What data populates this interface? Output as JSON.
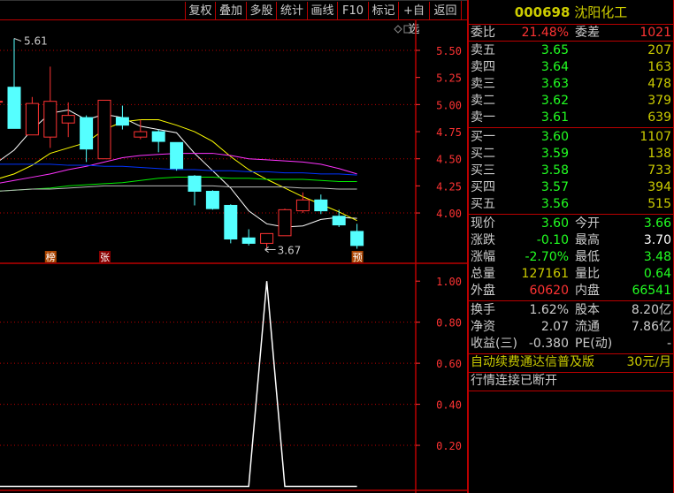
{
  "toolbar": {
    "buttons": [
      "复权",
      "叠加",
      "多股",
      "统计",
      "画线",
      "F10",
      "标记",
      "+自选",
      "返回"
    ]
  },
  "colors": {
    "up": "#ff3333",
    "down": "#55ffff",
    "ma5": "#ffffff",
    "ma10": "#ffff00",
    "ma20": "#ff33ff",
    "ma30": "#0033ff",
    "ma60": "#00ee00",
    "ma120": "#bbbbbb",
    "axis": "#ff3333"
  },
  "chart_data": [
    {
      "type": "candlestick",
      "title": "K线",
      "ylim": [
        3.6,
        5.65
      ],
      "yticks": [
        "5.50",
        "5.25",
        "5.00",
        "4.75",
        "4.50",
        "4.25",
        "4.00"
      ],
      "ytick_values": [
        5.5,
        5.25,
        5,
        4.75,
        4.5,
        4.25,
        4
      ],
      "ohlc": [
        [
          5.03,
          5.09,
          5.09,
          5.03
        ],
        [
          5.16,
          5.61,
          4.78,
          4.78
        ],
        [
          4.72,
          5.07,
          4.72,
          5.01
        ],
        [
          4.7,
          5.35,
          4.6,
          5.03
        ],
        [
          4.83,
          5.02,
          4.7,
          4.9
        ],
        [
          4.88,
          4.9,
          4.47,
          4.59
        ],
        [
          4.5,
          5.04,
          4.5,
          5.04
        ],
        [
          4.88,
          4.99,
          4.77,
          4.81
        ],
        [
          4.7,
          4.86,
          4.68,
          4.75
        ],
        [
          4.75,
          4.77,
          4.56,
          4.66
        ],
        [
          4.65,
          4.65,
          4.39,
          4.41
        ],
        [
          4.34,
          4.35,
          4.07,
          4.2
        ],
        [
          4.2,
          4.21,
          4.03,
          4.04
        ],
        [
          4.07,
          4.08,
          3.72,
          3.76
        ],
        [
          3.77,
          3.85,
          3.7,
          3.72
        ],
        [
          3.72,
          3.81,
          3.67,
          3.81
        ],
        [
          3.79,
          4.04,
          3.79,
          4.03
        ],
        [
          4.02,
          4.19,
          4.0,
          4.12
        ],
        [
          4.12,
          4.17,
          3.99,
          4.02
        ],
        [
          3.97,
          4.03,
          3.87,
          3.89
        ],
        [
          3.83,
          3.9,
          3.67,
          3.7
        ]
      ],
      "ma": {
        "ma5": [
          4.46,
          4.58,
          4.77,
          4.92,
          4.95,
          4.86,
          4.91,
          4.88,
          4.8,
          4.77,
          4.74,
          4.55,
          4.39,
          4.23,
          4.02,
          3.9,
          3.87,
          3.88,
          3.94,
          3.96,
          3.95
        ],
        "ma10": [
          4.31,
          4.36,
          4.44,
          4.55,
          4.6,
          4.65,
          4.77,
          4.84,
          4.86,
          4.86,
          4.81,
          4.75,
          4.66,
          4.52,
          4.4,
          4.31,
          4.23,
          4.15,
          4.08,
          4.01,
          3.93
        ],
        "ma20": [
          4.27,
          4.3,
          4.33,
          4.36,
          4.4,
          4.43,
          4.47,
          4.51,
          4.53,
          4.54,
          4.55,
          4.55,
          4.55,
          4.53,
          4.5,
          4.49,
          4.48,
          4.47,
          4.45,
          4.41,
          4.36
        ],
        "ma30": [
          4.45,
          4.45,
          4.45,
          4.45,
          4.44,
          4.44,
          4.43,
          4.43,
          4.42,
          4.41,
          4.4,
          4.4,
          4.39,
          4.39,
          4.38,
          4.38,
          4.37,
          4.37,
          4.36,
          4.36,
          4.35
        ],
        "ma60": [
          4.2,
          4.21,
          4.22,
          4.23,
          4.25,
          4.26,
          4.27,
          4.28,
          4.3,
          4.32,
          4.33,
          4.33,
          4.33,
          4.32,
          4.32,
          4.31,
          4.31,
          4.31,
          4.3,
          4.29,
          4.29
        ],
        "ma120": [
          4.2,
          4.21,
          4.22,
          4.22,
          4.23,
          4.24,
          4.25,
          4.25,
          4.25,
          4.25,
          4.25,
          4.25,
          4.25,
          4.24,
          4.24,
          4.24,
          4.24,
          4.23,
          4.23,
          4.22,
          4.22
        ]
      },
      "high_label": "5.61",
      "low_label": "3.67",
      "markers": [
        {
          "index": 3,
          "text": "榜"
        },
        {
          "index": 6,
          "text": "张"
        },
        {
          "index": 20,
          "text": "预"
        }
      ]
    },
    {
      "type": "line",
      "title": "指标",
      "ylim": [
        0,
        1.05
      ],
      "yticks": [
        "1.00",
        "0.80",
        "0.60",
        "0.40",
        "0.20"
      ],
      "ytick_values": [
        1,
        0.8,
        0.6,
        0.4,
        0.2
      ],
      "values": [
        0,
        0,
        0,
        0,
        0,
        0,
        0,
        0,
        0,
        0,
        0,
        0,
        0,
        0,
        0,
        1,
        0,
        0,
        0,
        0,
        0
      ]
    }
  ],
  "panel": {
    "code": "000698",
    "name": "沈阳化工",
    "weibi": {
      "label": "委比",
      "value": "21.48%",
      "label2": "委差",
      "value2": "1021"
    },
    "sell": [
      {
        "label": "卖五",
        "price": "3.65",
        "vol": "207"
      },
      {
        "label": "卖四",
        "price": "3.64",
        "vol": "163"
      },
      {
        "label": "卖三",
        "price": "3.63",
        "vol": "478"
      },
      {
        "label": "卖二",
        "price": "3.62",
        "vol": "379"
      },
      {
        "label": "卖一",
        "price": "3.61",
        "vol": "639"
      }
    ],
    "buy": [
      {
        "label": "买一",
        "price": "3.60",
        "vol": "1107"
      },
      {
        "label": "买二",
        "price": "3.59",
        "vol": "138"
      },
      {
        "label": "买三",
        "price": "3.58",
        "vol": "733"
      },
      {
        "label": "买四",
        "price": "3.57",
        "vol": "394"
      },
      {
        "label": "买五",
        "price": "3.56",
        "vol": "515"
      }
    ],
    "stats": [
      {
        "l1": "现价",
        "v1": "3.60",
        "c1": "g",
        "l2": "今开",
        "v2": "3.66",
        "c2": "g"
      },
      {
        "l1": "涨跌",
        "v1": "-0.10",
        "c1": "g",
        "l2": "最高",
        "v2": "3.70",
        "c2": "w"
      },
      {
        "l1": "涨幅",
        "v1": "-2.70%",
        "c1": "g",
        "l2": "最低",
        "v2": "3.48",
        "c2": "g"
      },
      {
        "l1": "总量",
        "v1": "127161",
        "c1": "y",
        "l2": "量比",
        "v2": "0.64",
        "c2": "g"
      },
      {
        "l1": "外盘",
        "v1": "60620",
        "c1": "r",
        "l2": "内盘",
        "v2": "66541",
        "c2": "g"
      }
    ],
    "fund": [
      {
        "l1": "换手",
        "v1": "1.62%",
        "l2": "股本",
        "v2": "8.20亿"
      },
      {
        "l1": "净资",
        "v1": "2.07",
        "l2": "流通",
        "v2": "7.86亿"
      },
      {
        "l1": "收益(三)",
        "v1": "-0.380",
        "l2": "PE(动)",
        "v2": "-"
      }
    ],
    "promo": "自动续费通达信普及版",
    "promo_price": "30元/月",
    "status": "行情连接已断开"
  }
}
